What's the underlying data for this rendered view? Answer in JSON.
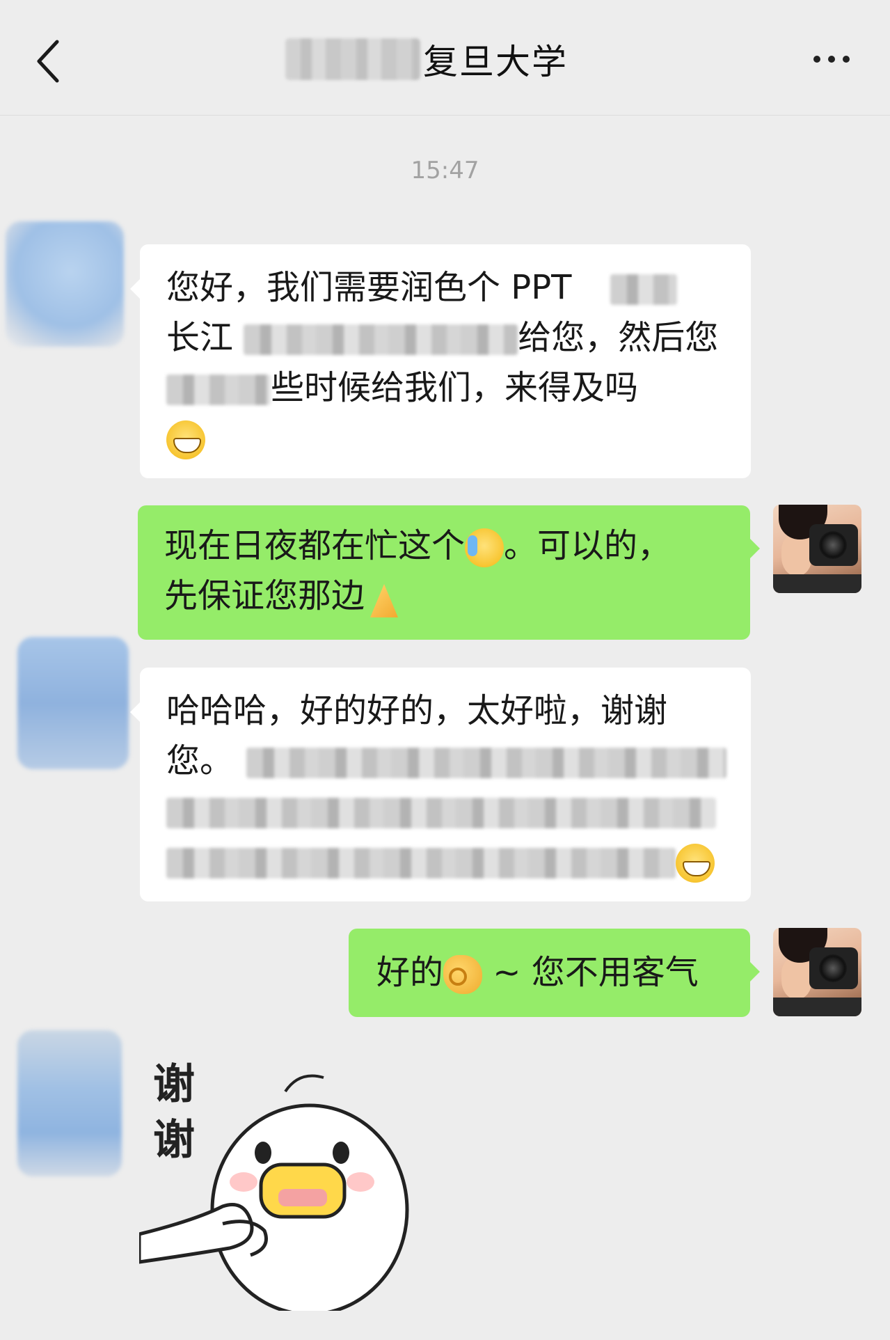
{
  "header": {
    "title": "复旦大学",
    "back_icon": "chevron-left-icon",
    "more_icon": "more-dots-icon"
  },
  "timestamp": "15:47",
  "messages": [
    {
      "side": "left",
      "lines": [
        "您好，我们需要润色个 PPT",
        "长江",
        "给您，然后您",
        "些时候给我们，来得及吗"
      ],
      "emoji": "grin-emoji"
    },
    {
      "side": "right",
      "line1_a": "现在日夜都在忙这个",
      "line1_b": "。可以的，",
      "line2": "先保证您那边",
      "emojis": [
        "tears-of-joy-emoji",
        "pray-hands-emoji"
      ]
    },
    {
      "side": "left",
      "line1": "哈哈哈，好的好的，太好啦，谢谢",
      "line2": "您。",
      "emoji": "grin-emoji"
    },
    {
      "side": "right",
      "text_a": "好的",
      "text_b": " ~ 您不用客气",
      "emoji": "ok-hand-emoji"
    }
  ],
  "sticker": {
    "text_top": "谢",
    "text_bottom": "谢",
    "name": "duck-thanks-sticker"
  },
  "colors": {
    "background": "#ededed",
    "outgoing_bubble": "#95ec69",
    "incoming_bubble": "#ffffff"
  }
}
